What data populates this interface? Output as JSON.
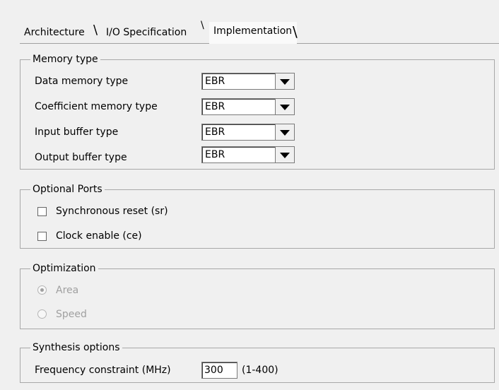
{
  "tabs": [
    {
      "label": "Architecture"
    },
    {
      "label": "I/O Specification"
    },
    {
      "label": "Implementation"
    }
  ],
  "memory_type": {
    "legend": "Memory type",
    "rows": [
      {
        "label": "Data memory type",
        "value": "EBR"
      },
      {
        "label": "Coefficient memory type",
        "value": "EBR"
      },
      {
        "label": "Input buffer type",
        "value": "EBR"
      },
      {
        "label": "Output buffer type",
        "value": "EBR"
      }
    ]
  },
  "optional_ports": {
    "legend": "Optional Ports",
    "items": [
      {
        "label": "Synchronous reset (sr)",
        "checked": false
      },
      {
        "label": "Clock enable (ce)",
        "checked": false
      }
    ]
  },
  "optimization": {
    "legend": "Optimization",
    "options": [
      {
        "label": "Area",
        "selected": true,
        "enabled": false
      },
      {
        "label": "Speed",
        "selected": false,
        "enabled": false
      }
    ]
  },
  "synthesis": {
    "legend": "Synthesis options",
    "frequency_label": "Frequency constraint (MHz)",
    "frequency_value": "300",
    "frequency_range": "(1-400)"
  }
}
